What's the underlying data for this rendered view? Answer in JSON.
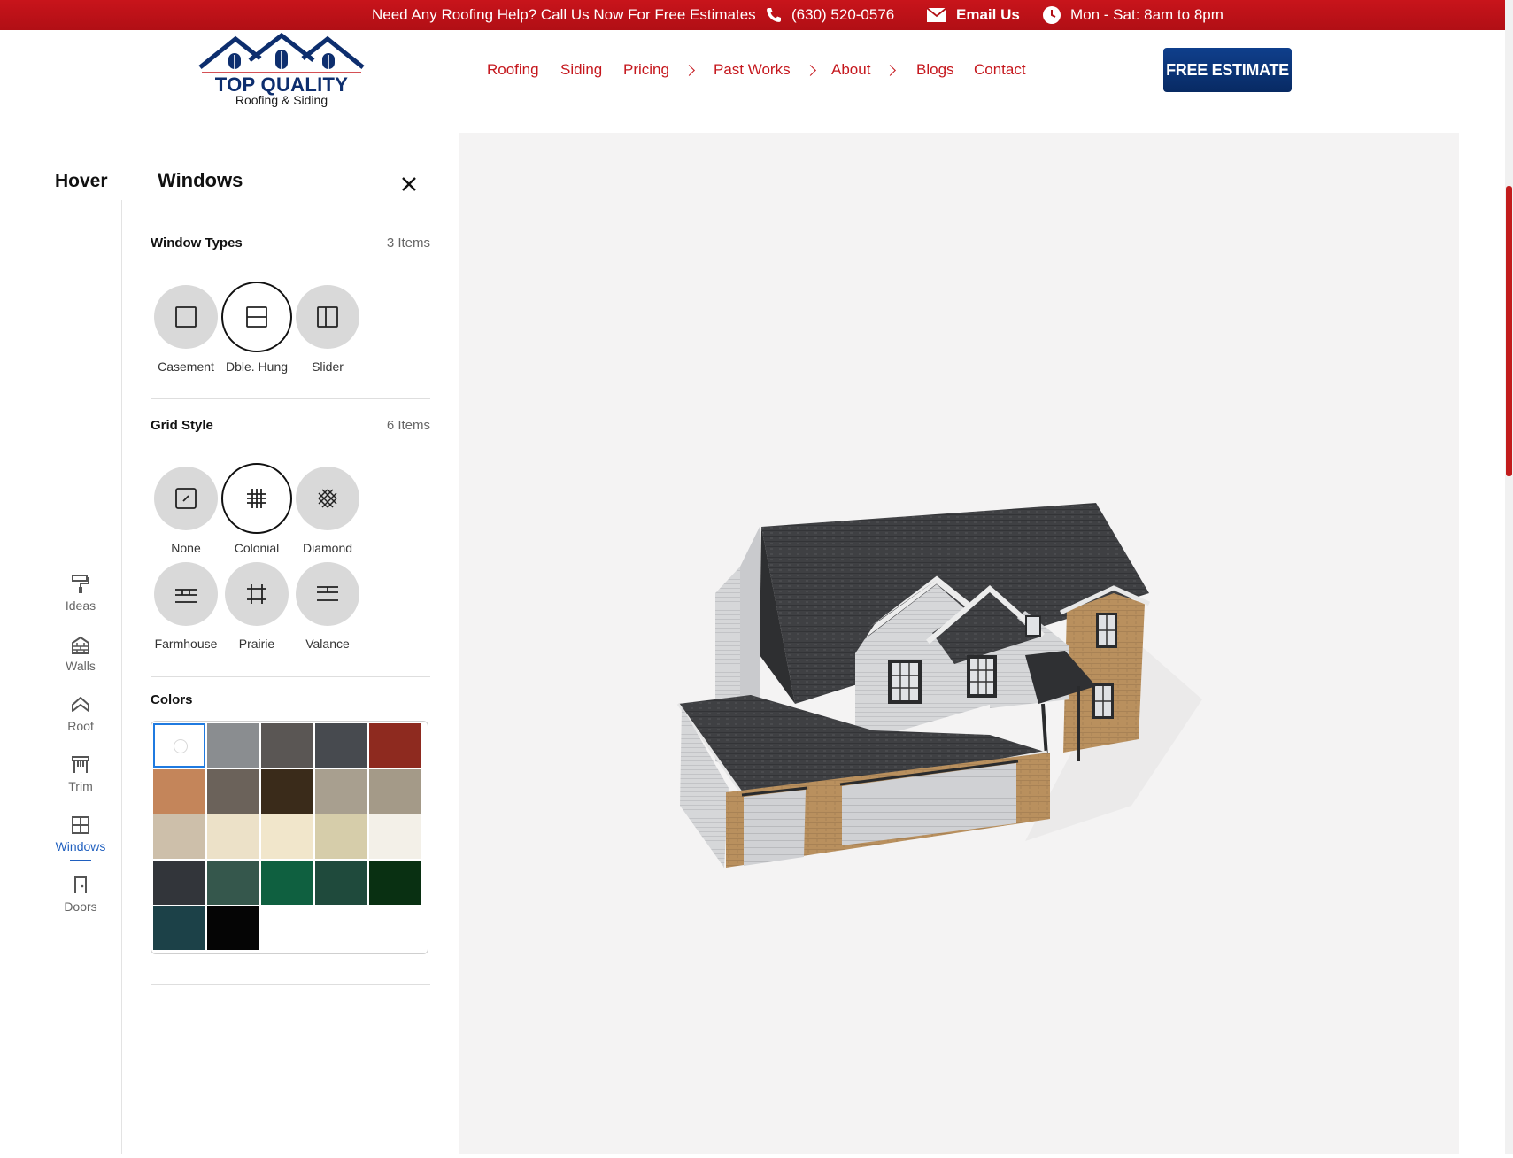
{
  "topbar": {
    "help_text": "Need Any Roofing Help? Call Us Now For Free Estimates",
    "phone": "(630) 520-0576",
    "email_label": "Email Us",
    "hours": "Mon - Sat: 8am to 8pm",
    "icons": [
      "phone-icon",
      "mail-icon",
      "clock-icon"
    ]
  },
  "logo": {
    "brand": "TOP QUALITY",
    "tagline": "Roofing & Siding"
  },
  "nav": {
    "items": [
      "Roofing",
      "Siding",
      "Pricing",
      "Past Works",
      "About",
      "Blogs",
      "Contact"
    ],
    "cta": "FREE ESTIMATE"
  },
  "rail": {
    "title": "Hover",
    "items": [
      {
        "label": "Ideas",
        "icon": "paint-roller-icon"
      },
      {
        "label": "Walls",
        "icon": "brick-wall-icon"
      },
      {
        "label": "Roof",
        "icon": "roof-icon"
      },
      {
        "label": "Trim",
        "icon": "trim-icon"
      },
      {
        "label": "Windows",
        "icon": "window-icon"
      },
      {
        "label": "Doors",
        "icon": "door-icon"
      }
    ],
    "active": "Windows"
  },
  "panel": {
    "title": "Windows",
    "window_types": {
      "title": "Window Types",
      "count": "3 Items",
      "options": [
        "Casement",
        "Dble. Hung",
        "Slider"
      ],
      "selected": "Dble. Hung"
    },
    "grid_style": {
      "title": "Grid Style",
      "count": "6 Items",
      "options": [
        "None",
        "Colonial",
        "Diamond",
        "Farmhouse",
        "Prairie",
        "Valance"
      ],
      "selected": "Colonial"
    },
    "colors": {
      "title": "Colors",
      "swatches": [
        "#ffffff",
        "#8a8d90",
        "#5a5654",
        "#474a4f",
        "#8e2a1f",
        "#c4855a",
        "#6b625a",
        "#3a2b1a",
        "#a89f8f",
        "#a49a88",
        "#cdbfaa",
        "#ece1c8",
        "#f1e6cb",
        "#d6cdaa",
        "#f3f0e8",
        "#32353a",
        "#35574c",
        "#0f6040",
        "#1f4a3c",
        "#093012",
        "#1c4148",
        "#050505"
      ],
      "selected_index": 0
    }
  },
  "accent": {
    "brand_red": "#c5171d",
    "brand_blue": "#0d2e6e",
    "active_blue": "#1f5fbf"
  }
}
